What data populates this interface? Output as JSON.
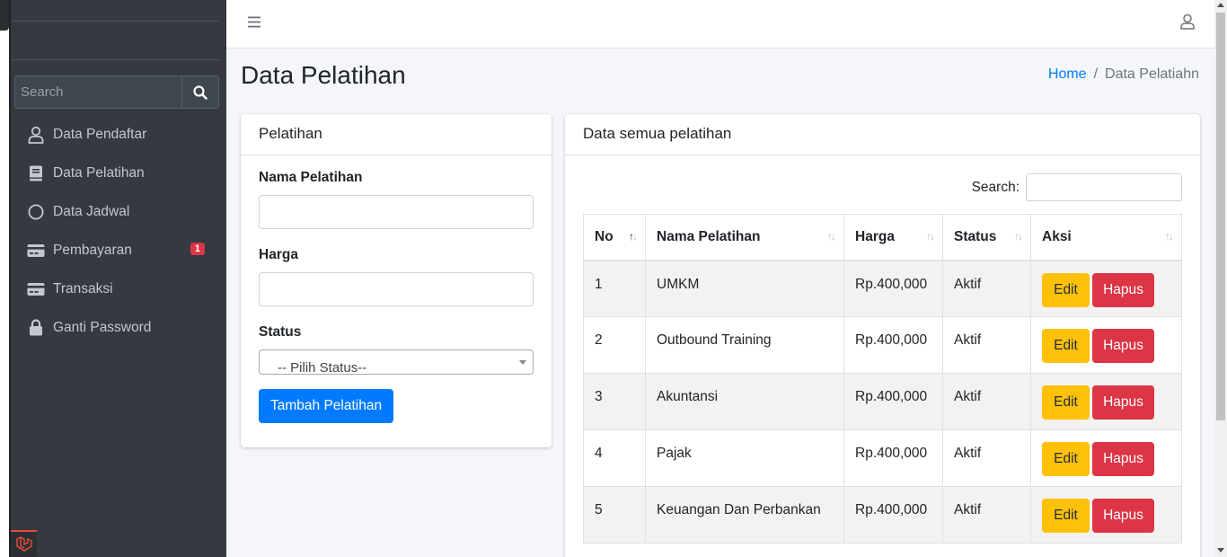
{
  "sidebar": {
    "search_placeholder": "Search",
    "items": [
      {
        "label": "Data Pendaftar",
        "icon": "user-icon"
      },
      {
        "label": "Data Pelatihan",
        "icon": "book-icon"
      },
      {
        "label": "Data Jadwal",
        "icon": "circle-icon"
      },
      {
        "label": "Pembayaran",
        "icon": "credit-card-icon",
        "badge": "1"
      },
      {
        "label": "Transaksi",
        "icon": "credit-card-icon"
      },
      {
        "label": "Ganti Password",
        "icon": "lock-icon"
      }
    ]
  },
  "header": {
    "page_title": "Data Pelatihan",
    "breadcrumb_home": "Home",
    "breadcrumb_sep": "/",
    "breadcrumb_current": "Data Pelatiahn"
  },
  "form_card": {
    "title": "Pelatihan",
    "nama_label": "Nama Pelatihan",
    "harga_label": "Harga",
    "status_label": "Status",
    "status_selected": "-- Pilih Status--",
    "submit_label": "Tambah Pelatihan"
  },
  "table_card": {
    "title": "Data semua pelatihan",
    "search_label": "Search:",
    "columns": [
      "No",
      "Nama Pelatihan",
      "Harga",
      "Status",
      "Aksi"
    ],
    "edit_label": "Edit",
    "delete_label": "Hapus",
    "rows": [
      {
        "no": "1",
        "nama": "UMKM",
        "harga": "Rp.400,000",
        "status": "Aktif"
      },
      {
        "no": "2",
        "nama": "Outbound Training",
        "harga": "Rp.400,000",
        "status": "Aktif"
      },
      {
        "no": "3",
        "nama": "Akuntansi",
        "harga": "Rp.400,000",
        "status": "Aktif"
      },
      {
        "no": "4",
        "nama": "Pajak",
        "harga": "Rp.400,000",
        "status": "Aktif"
      },
      {
        "no": "5",
        "nama": "Keuangan Dan Perbankan",
        "harga": "Rp.400,000",
        "status": "Aktif"
      }
    ]
  },
  "colors": {
    "sidebar_bg": "#343a40",
    "primary": "#007bff",
    "warning": "#ffc107",
    "danger": "#dc3545"
  }
}
